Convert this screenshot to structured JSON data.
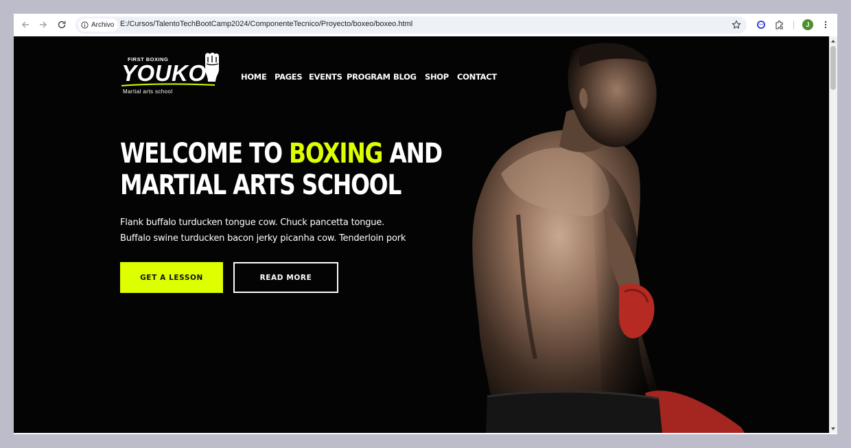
{
  "browser": {
    "site_chip_label": "Archivo",
    "url": "E:/Cursos/TalentoTechBootCamp2024/ComponenteTecnico/Proyecto/boxeo/boxeo.html",
    "profile_initial": "J",
    "icons": [
      "back-icon",
      "forward-icon",
      "reload-icon",
      "info-icon",
      "star-icon",
      "extension-puzzle-icon",
      "menu-dots-icon"
    ]
  },
  "logo": {
    "top_text": "FIRST BOXING",
    "main_text": "YOUKO",
    "sub_text": "Martial arts school"
  },
  "nav": {
    "items": [
      "HOME",
      "PAGES",
      "EVENTS",
      "PROGRAM",
      "BLOG",
      "SHOP",
      "CONTACT"
    ]
  },
  "hero": {
    "title_part1": "WELCOME TO ",
    "title_accent": "BOXING",
    "title_part2": " AND",
    "title_line2": "MARTIAL ARTS SCHOOL",
    "description": "Flank buffalo turducken tongue cow. Chuck pancetta tongue. Buffalo swine turducken bacon jerky picanha cow. Tenderloin pork",
    "primary_button": "GET A LESSON",
    "secondary_button": "READ MORE"
  },
  "colors": {
    "accent": "#ddff00",
    "background": "#040404",
    "window_frame": "#bdbccb"
  }
}
